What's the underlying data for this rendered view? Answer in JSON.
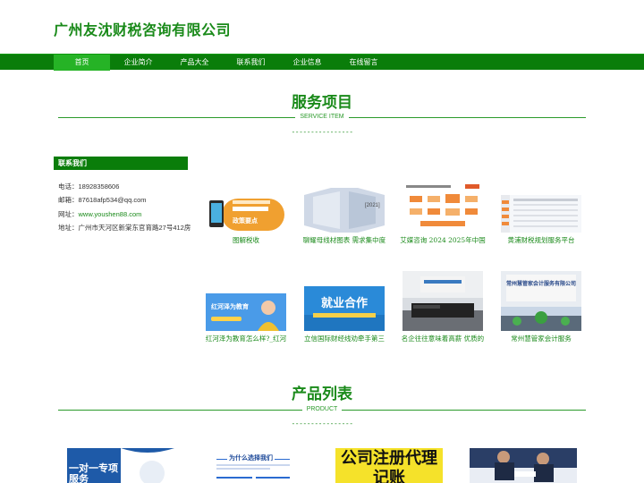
{
  "site": {
    "title": "广州友沈财税咨询有限公司"
  },
  "nav": {
    "items": [
      {
        "label": "首页"
      },
      {
        "label": "企业简介"
      },
      {
        "label": "产品大全"
      },
      {
        "label": "联系我们"
      },
      {
        "label": "企业信息"
      },
      {
        "label": "在线留言"
      }
    ]
  },
  "services": {
    "title": "服务项目",
    "subtitle": "SERVICE ITEM",
    "dashes": "----------------"
  },
  "contact": {
    "heading": "联系我们",
    "phone_label": "电话：",
    "phone": "18928358606",
    "email_label": "邮箱：",
    "email": "87618afp534@qq.com",
    "website_label": "网址：",
    "website": "www.youshen88.com",
    "address_label": "地址：",
    "address": "广州市天河区新棠东官育路27号412房"
  },
  "service_cards": [
    {
      "label": "图解税收",
      "thumb_text": "政策要点"
    },
    {
      "label": "聊耀母线材图表 需求集中度",
      "thumb_text": "[2021]"
    },
    {
      "label": "艾媒咨询 2024 2025年中国",
      "thumb_text": ""
    },
    {
      "label": "黄浦财税规划服务平台",
      "thumb_text": ""
    },
    {
      "label": "红河泽为教育怎么样?_红河",
      "thumb_text": "红河泽为教育"
    },
    {
      "label": "立信国际财经线劝牵手第三",
      "thumb_text": "就业合作"
    },
    {
      "label": "名企往往意味着高薪 优质的",
      "thumb_text": ""
    },
    {
      "label": "常州慧管家会计服务",
      "thumb_text": "常州慧管家会计服务有限公司"
    }
  ],
  "products": {
    "title": "产品列表",
    "subtitle": "PRODUCT",
    "dashes": "----------------",
    "items": [
      {
        "thumb_text": "一对一专项服务"
      },
      {
        "thumb_text": "为什么选择我们"
      },
      {
        "thumb_text": "公司注册代理记账"
      },
      {
        "thumb_text": ""
      }
    ]
  },
  "colors": {
    "brand_green": "#0a7d0a",
    "text_green": "#1a8a1a",
    "nav_active": "#26b326"
  }
}
